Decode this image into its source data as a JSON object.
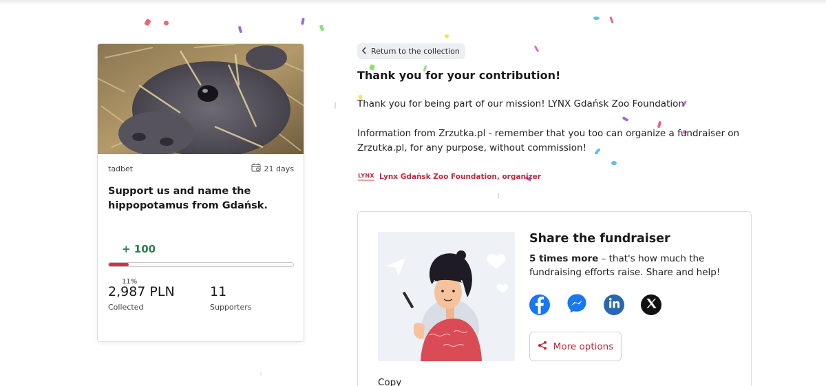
{
  "card": {
    "author": "tadbet",
    "days": "21 days",
    "title": "Support us and name the hippopotamus from Gdańsk.",
    "plus_amount": "+ 100",
    "progress_fraction": 0.11,
    "progress_percent": "11%",
    "collected_amount": "2,987 PLN",
    "collected_label": "Collected",
    "supporters_count": "11",
    "supporters_label": "Supporters"
  },
  "main": {
    "return_label": "Return to the collection",
    "thanks_title": "Thank you for your contribution!",
    "thanks_line1": "Thank you for being part of our mission! LYNX Gdańsk Zoo Foundation",
    "thanks_line2": "Information from Zrzutka.pl - remember that you too can organize a fundraiser on Zrzutka.pl, for any purpose, without commission!",
    "organizer_logo_text": "LYNX",
    "organizer": "Lynx Gdańsk Zoo Foundation, organizer"
  },
  "share": {
    "title": "Share the fundraiser",
    "text_bold": "5 times more",
    "text_rest": " – that's how much the fundraising efforts raise. Share and help!",
    "more_options_label": "More options",
    "copy_label": "Copy",
    "socials": [
      "facebook-icon",
      "messenger-icon",
      "linkedin-icon",
      "x-icon"
    ]
  },
  "colors": {
    "accent": "#c0283a",
    "progress": "#d2334a",
    "plus_green": "#2e7d4f",
    "facebook": "#1877f2",
    "linkedin": "#2867b2",
    "x": "#111111"
  }
}
